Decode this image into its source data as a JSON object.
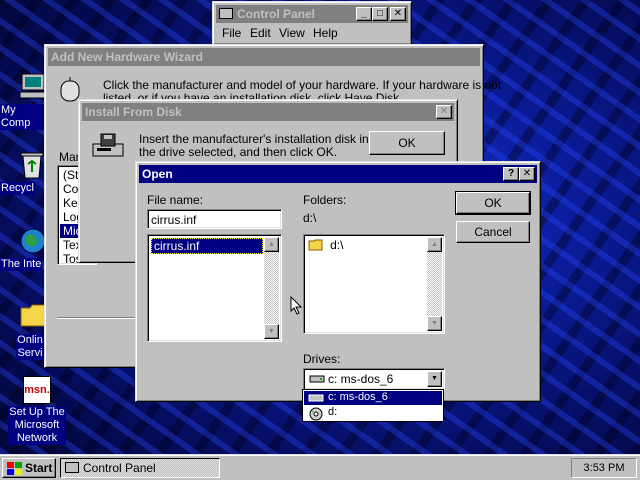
{
  "desktop": {
    "icons": [
      {
        "label": "My Comp"
      },
      {
        "label": "Recycl"
      },
      {
        "label": "The Inte"
      },
      {
        "label": "Onlin\nServi"
      },
      {
        "label": "Set Up The\nMicrosoft\nNetwork"
      }
    ],
    "msn_logo_text": "msn."
  },
  "control_panel": {
    "title": "Control Panel",
    "menu": [
      "File",
      "Edit",
      "View",
      "Help"
    ]
  },
  "wizard": {
    "title": "Add New Hardware Wizard",
    "instructions_line1": "Click the manufacturer and model of your hardware. If your hardware is not",
    "instructions_line2": "listed, or if you have an installation disk, click Have Disk.",
    "manufacturers_label": "Man",
    "manufacturers": [
      "(Sta",
      "Cor",
      "Ker",
      "Log",
      "Mic",
      "Tex",
      "Tos"
    ]
  },
  "install_from_disk": {
    "title": "Install From Disk",
    "message_line1": "Insert the manufacturer's installation disk into",
    "message_line2": "the drive selected, and then click OK.",
    "ok_label": "OK"
  },
  "open_dialog": {
    "title": "Open",
    "help_btn": "?",
    "close_btn": "✕",
    "file_name_label": "File name:",
    "file_name_value": "cirrus.inf",
    "files": [
      "cirrus.inf"
    ],
    "folders_label": "Folders:",
    "current_path": "d:\\",
    "folders": [
      "d:\\"
    ],
    "drives_label": "Drives:",
    "drive_selected": "c: ms-dos_6",
    "drive_options": [
      "c: ms-dos_6",
      "d:"
    ],
    "ok_label": "OK",
    "cancel_label": "Cancel"
  },
  "taskbar": {
    "start_label": "Start",
    "task_button": "Control Panel",
    "clock": "3:53 PM"
  },
  "colors": {
    "title_active": "#000080",
    "title_inactive": "#808080",
    "face": "#c0c0c0",
    "selection": "#000080"
  }
}
